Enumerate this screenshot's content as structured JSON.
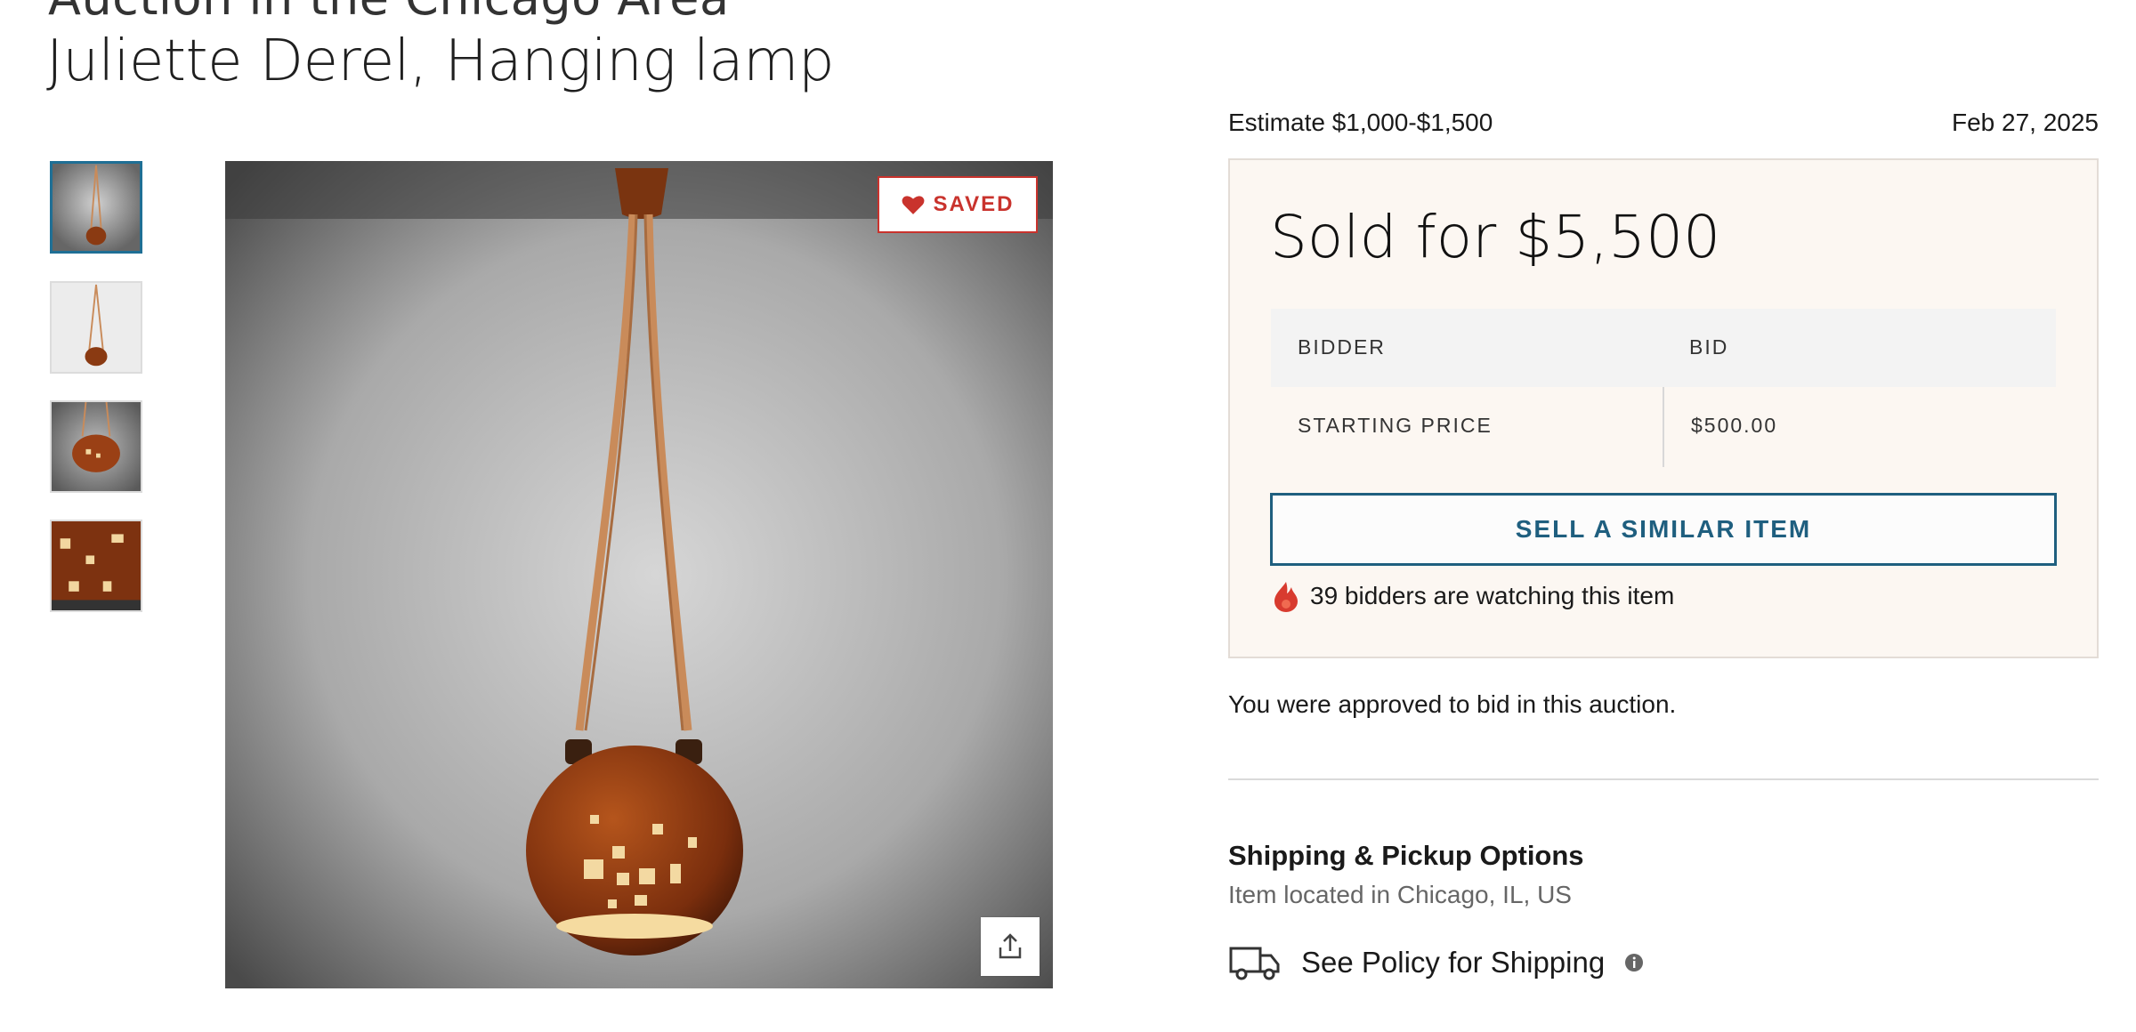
{
  "header": {
    "title": "Juliette Derel, Hanging lamp"
  },
  "gallery": {
    "thumbnails": [
      "thumbnail-1",
      "thumbnail-2",
      "thumbnail-3",
      "thumbnail-4"
    ],
    "saved_label": "SAVED"
  },
  "auction": {
    "estimate": "Estimate $1,000-$1,500",
    "date": "Feb 27, 2025",
    "sold_text": "Sold for $5,500",
    "table": {
      "headers": [
        "BIDDER",
        "BID"
      ],
      "rows": [
        [
          "STARTING PRICE",
          "$500.00"
        ]
      ]
    },
    "sell_button": "SELL A SIMILAR ITEM",
    "watchers": "39 bidders are watching this item",
    "approved": "You were approved to bid in this auction."
  },
  "shipping": {
    "title": "Shipping & Pickup Options",
    "location": "Item located in Chicago, IL, US",
    "policy_link": "See Policy for Shipping"
  },
  "colors": {
    "accent_blue": "#1f5f7f",
    "saved_red": "#c9332d",
    "panel_bg": "#fcf7f2"
  },
  "icons": [
    "heart-icon",
    "share-icon",
    "flame-icon",
    "truck-icon",
    "info-icon"
  ]
}
